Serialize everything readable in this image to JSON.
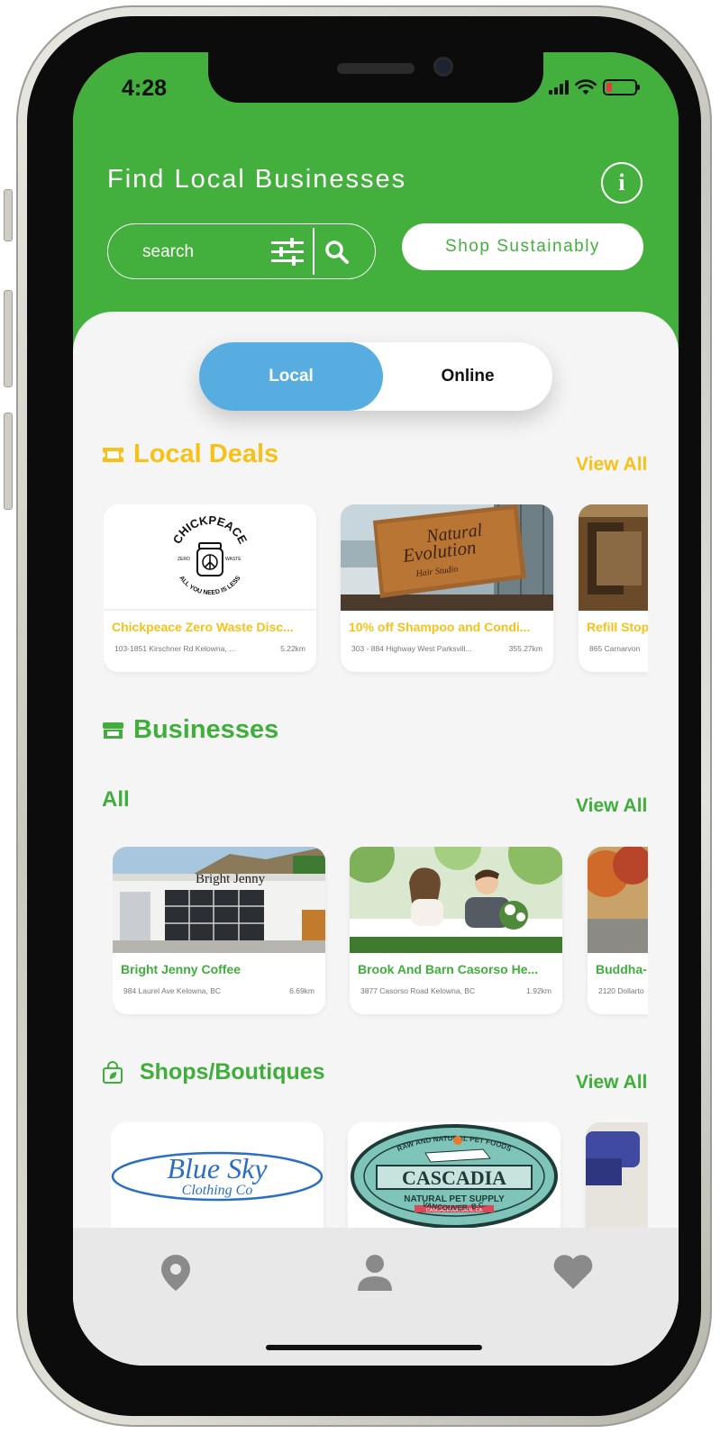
{
  "status_bar": {
    "time": "4:28"
  },
  "header": {
    "title": "Find Local Businesses",
    "info_icon": "info-icon",
    "search_placeholder": "search",
    "filter_icon": "sliders-icon",
    "search_icon": "magnifier-icon",
    "shop_button_label": "Shop Sustainably"
  },
  "toggle": {
    "local_label": "Local",
    "online_label": "Online",
    "selected": "Local"
  },
  "local_deals": {
    "title": "Local Deals",
    "icon": "ticket-icon",
    "view_all_label": "View All",
    "cards": [
      {
        "title": "Chickpeace Zero Waste Disc...",
        "address": "103-1851 Kirschner Rd Kelowna, ...",
        "distance": "5.22km",
        "logo_top": "CHICKPEACE",
        "logo_left": "ZERO",
        "logo_right": "WASTE",
        "logo_bottom": "ALL YOU NEED IS LESS"
      },
      {
        "title": "10% off Shampoo and Condi...",
        "address": "303 - 884 Highway West Parksvill...",
        "distance": "355.27km",
        "sign_line1": "Natural",
        "sign_line2": "Evolution",
        "sign_line3": "Hair Studio"
      },
      {
        "title": "Refill Stop",
        "address": "865 Carnarvon",
        "distance": ""
      }
    ]
  },
  "businesses": {
    "title": "Businesses",
    "icon": "storefront-icon",
    "subsection_title": "All",
    "view_all_label": "View All",
    "cards": [
      {
        "title": "Bright Jenny Coffee",
        "address": "984 Laurel Ave Kelowna, BC",
        "distance": "6.69km",
        "sign_text": "Bright Jenny"
      },
      {
        "title": "Brook And Barn Casorso He...",
        "address": "3877 Casorso Road Kelowna, BC",
        "distance": "1.92km"
      },
      {
        "title": "Buddha-",
        "address": "2120 Dollarto",
        "distance": ""
      }
    ]
  },
  "shops": {
    "title": "Shops/Boutiques",
    "icon": "shopping-bag-icon",
    "view_all_label": "View All",
    "cards": [
      {
        "logo_line1": "Blue Sky",
        "logo_line2": "Clothing Co"
      },
      {
        "logo_name": "CASCADIA",
        "logo_line2": "NATURAL PET SUPPLY",
        "logo_arc_top": "RAW AND NATURAL PET FOODS",
        "logo_arc_bottom": "VANCOUVER, B.C.",
        "logo_url": "CASCADIANATURAL.CA"
      },
      {}
    ]
  },
  "bottom_nav": {
    "items": [
      {
        "icon": "map-pin-icon"
      },
      {
        "icon": "user-icon"
      },
      {
        "icon": "heart-icon"
      }
    ]
  },
  "colors": {
    "brand_green": "#43b03d",
    "accent_yellow": "#f6c21a",
    "toggle_blue": "#57ade0"
  }
}
